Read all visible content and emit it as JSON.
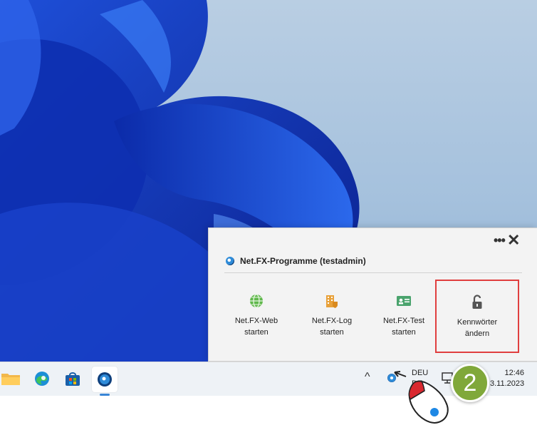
{
  "flyout": {
    "more_label": "•••",
    "close_label": "✕",
    "title": "Net.FX-Programme (testadmin)",
    "tiles": [
      {
        "line1": "Net.FX-Web",
        "line2": "starten",
        "icon": "globe-icon"
      },
      {
        "line1": "Net.FX-Log",
        "line2": "starten",
        "icon": "log-building-icon"
      },
      {
        "line1": "Net.FX-Test",
        "line2": "starten",
        "icon": "id-card-icon"
      },
      {
        "line1": "Kennwörter",
        "line2": "ändern",
        "icon": "unlock-icon"
      }
    ],
    "highlight_color": "#e03e3e"
  },
  "taskbar": {
    "apps": [
      "file-explorer-icon",
      "edge-icon",
      "store-icon",
      "netfx-app-icon"
    ],
    "chevron": "^",
    "language_line1": "DEU",
    "language_line2": "DE",
    "time": "12:46",
    "date": "3.11.2023"
  },
  "badge": {
    "label": "2",
    "color": "#80a83a"
  }
}
